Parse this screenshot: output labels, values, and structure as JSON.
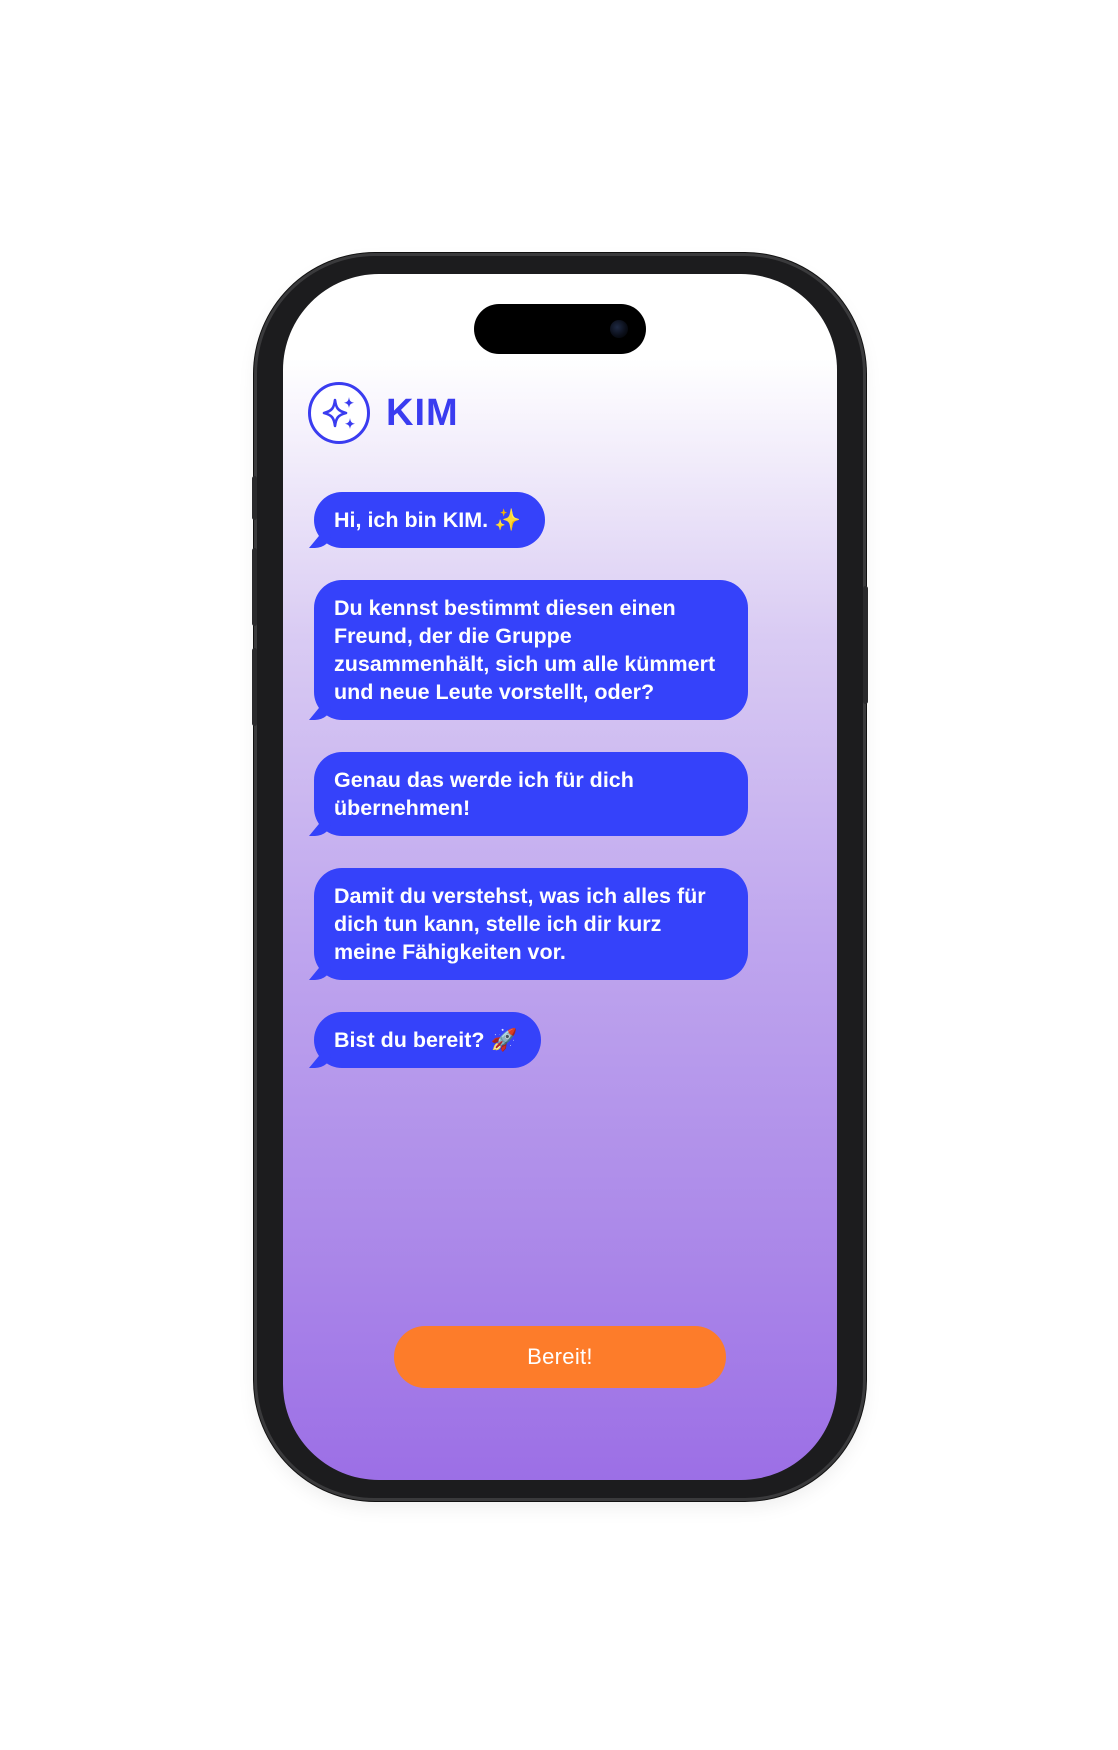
{
  "app": {
    "name": "KIM",
    "logo_icon": "sparkles-icon",
    "accent_color": "#3542FA",
    "cta_color": "#FD7C2A",
    "background_gradient": [
      "#FFFFFF",
      "#9C6FE6"
    ]
  },
  "messages": [
    {
      "text": "Hi, ich bin KIM. ✨"
    },
    {
      "text": "Du kennst bestimmt diesen einen Freund, der die Gruppe zusammenhält, sich um alle kümmert und neue Leute vorstellt, oder?"
    },
    {
      "text": "Genau das werde ich für dich übernehmen!"
    },
    {
      "text": "Damit du verstehst, was ich alles für dich tun kann, stelle ich dir kurz meine Fähigkeiten vor."
    },
    {
      "text": "Bist du bereit? 🚀"
    }
  ],
  "cta": {
    "label": "Bereit!"
  }
}
